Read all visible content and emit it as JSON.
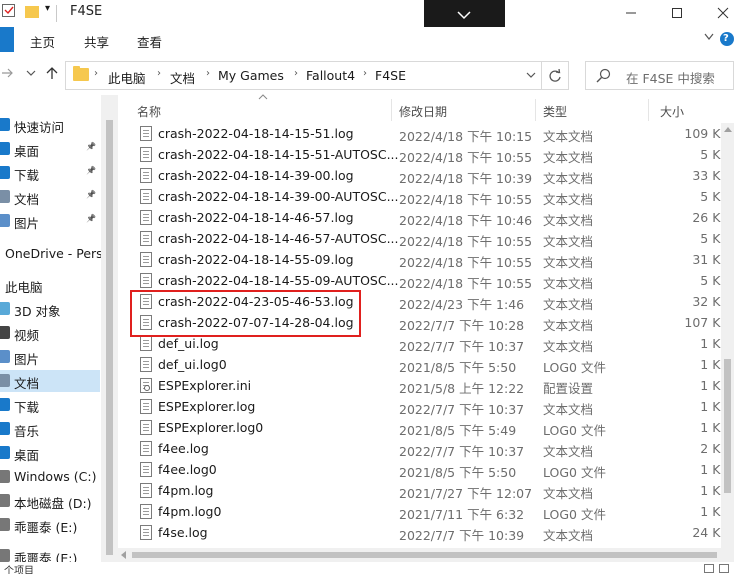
{
  "window": {
    "title": "F4SE",
    "ribbon_tabs": [
      "主页",
      "共享",
      "查看"
    ],
    "help": "?"
  },
  "address": {
    "crumbs": [
      "此电脑",
      "文档",
      "My Games",
      "Fallout4",
      "F4SE"
    ],
    "search_placeholder": "在 F4SE 中搜索"
  },
  "sidebar": {
    "items": [
      {
        "label": "快速访问",
        "icon": "star-icon",
        "pinned": false
      },
      {
        "label": "桌面",
        "icon": "desktop-icon",
        "pinned": true
      },
      {
        "label": "下载",
        "icon": "download-icon",
        "pinned": true
      },
      {
        "label": "文档",
        "icon": "document-icon",
        "pinned": true
      },
      {
        "label": "图片",
        "icon": "picture-icon",
        "pinned": true
      },
      {
        "label": "OneDrive - Perso",
        "icon": "cloud-icon",
        "pinned": false
      },
      {
        "label": "此电脑",
        "icon": "computer-icon",
        "pinned": false
      },
      {
        "label": "3D 对象",
        "icon": "cube-icon",
        "pinned": false
      },
      {
        "label": "视频",
        "icon": "video-icon",
        "pinned": false
      },
      {
        "label": "图片",
        "icon": "picture-icon",
        "pinned": false
      },
      {
        "label": "文档",
        "icon": "document-icon",
        "pinned": false,
        "selected": true
      },
      {
        "label": "下载",
        "icon": "download-icon",
        "pinned": false
      },
      {
        "label": "音乐",
        "icon": "music-icon",
        "pinned": false
      },
      {
        "label": "桌面",
        "icon": "desktop-icon",
        "pinned": false
      },
      {
        "label": "Windows (C:)",
        "icon": "drive-icon",
        "pinned": false
      },
      {
        "label": "本地磁盘 (D:)",
        "icon": "drive-icon",
        "pinned": false
      },
      {
        "label": "乖噩泰 (E:)",
        "icon": "drive-icon",
        "pinned": false
      },
      {
        "label": "乖噩泰 (E:)",
        "icon": "drive-icon",
        "pinned": false
      }
    ],
    "pin_glyph": "📌"
  },
  "columns": {
    "name": "名称",
    "modified": "修改日期",
    "type": "类型",
    "size": "大小"
  },
  "files": [
    {
      "name": "crash-2022-04-18-14-15-51.log",
      "modified": "2022/4/18 下午 10:15",
      "type": "文本文档",
      "size": "109 KB",
      "icon": "text-file-icon"
    },
    {
      "name": "crash-2022-04-18-14-15-51-AUTOSC...",
      "modified": "2022/4/18 下午 10:55",
      "type": "文本文档",
      "size": "5 KB",
      "icon": "text-file-icon"
    },
    {
      "name": "crash-2022-04-18-14-39-00.log",
      "modified": "2022/4/18 下午 10:39",
      "type": "文本文档",
      "size": "33 KB",
      "icon": "text-file-icon"
    },
    {
      "name": "crash-2022-04-18-14-39-00-AUTOSC...",
      "modified": "2022/4/18 下午 10:55",
      "type": "文本文档",
      "size": "5 KB",
      "icon": "text-file-icon"
    },
    {
      "name": "crash-2022-04-18-14-46-57.log",
      "modified": "2022/4/18 下午 10:46",
      "type": "文本文档",
      "size": "26 KB",
      "icon": "text-file-icon"
    },
    {
      "name": "crash-2022-04-18-14-46-57-AUTOSC...",
      "modified": "2022/4/18 下午 10:55",
      "type": "文本文档",
      "size": "5 KB",
      "icon": "text-file-icon"
    },
    {
      "name": "crash-2022-04-18-14-55-09.log",
      "modified": "2022/4/18 下午 10:55",
      "type": "文本文档",
      "size": "31 KB",
      "icon": "text-file-icon"
    },
    {
      "name": "crash-2022-04-18-14-55-09-AUTOSC...",
      "modified": "2022/4/18 下午 10:55",
      "type": "文本文档",
      "size": "5 KB",
      "icon": "text-file-icon"
    },
    {
      "name": "crash-2022-04-23-05-46-53.log",
      "modified": "2022/4/23 下午 1:46",
      "type": "文本文档",
      "size": "32 KB",
      "icon": "text-file-icon"
    },
    {
      "name": "crash-2022-07-07-14-28-04.log",
      "modified": "2022/7/7 下午 10:28",
      "type": "文本文档",
      "size": "107 KB",
      "icon": "text-file-icon"
    },
    {
      "name": "def_ui.log",
      "modified": "2022/7/7 下午 10:37",
      "type": "文本文档",
      "size": "1 KB",
      "icon": "text-file-icon"
    },
    {
      "name": "def_ui.log0",
      "modified": "2021/8/5 下午 5:50",
      "type": "LOG0 文件",
      "size": "1 KB",
      "icon": "text-file-icon"
    },
    {
      "name": "ESPExplorer.ini",
      "modified": "2021/5/8 上午 12:22",
      "type": "配置设置",
      "size": "1 KB",
      "icon": "settings-file-icon"
    },
    {
      "name": "ESPExplorer.log",
      "modified": "2022/7/7 下午 10:37",
      "type": "文本文档",
      "size": "1 KB",
      "icon": "text-file-icon"
    },
    {
      "name": "ESPExplorer.log0",
      "modified": "2021/8/5 下午 5:49",
      "type": "LOG0 文件",
      "size": "1 KB",
      "icon": "text-file-icon"
    },
    {
      "name": "f4ee.log",
      "modified": "2022/7/7 下午 10:37",
      "type": "文本文档",
      "size": "2 KB",
      "icon": "text-file-icon"
    },
    {
      "name": "f4ee.log0",
      "modified": "2021/8/5 下午 5:50",
      "type": "LOG0 文件",
      "size": "1 KB",
      "icon": "text-file-icon"
    },
    {
      "name": "f4pm.log",
      "modified": "2021/7/27 下午 12:07",
      "type": "文本文档",
      "size": "1 KB",
      "icon": "text-file-icon"
    },
    {
      "name": "f4pm.log0",
      "modified": "2021/7/11 下午 6:32",
      "type": "LOG0 文件",
      "size": "1 KB",
      "icon": "text-file-icon"
    },
    {
      "name": "f4se.log",
      "modified": "2022/7/7 下午 10:39",
      "type": "文本文档",
      "size": "24 KB",
      "icon": "text-file-icon"
    }
  ],
  "highlight_color": "#e0201e",
  "accent": "#1979ca",
  "status": {
    "text": "个项目"
  }
}
